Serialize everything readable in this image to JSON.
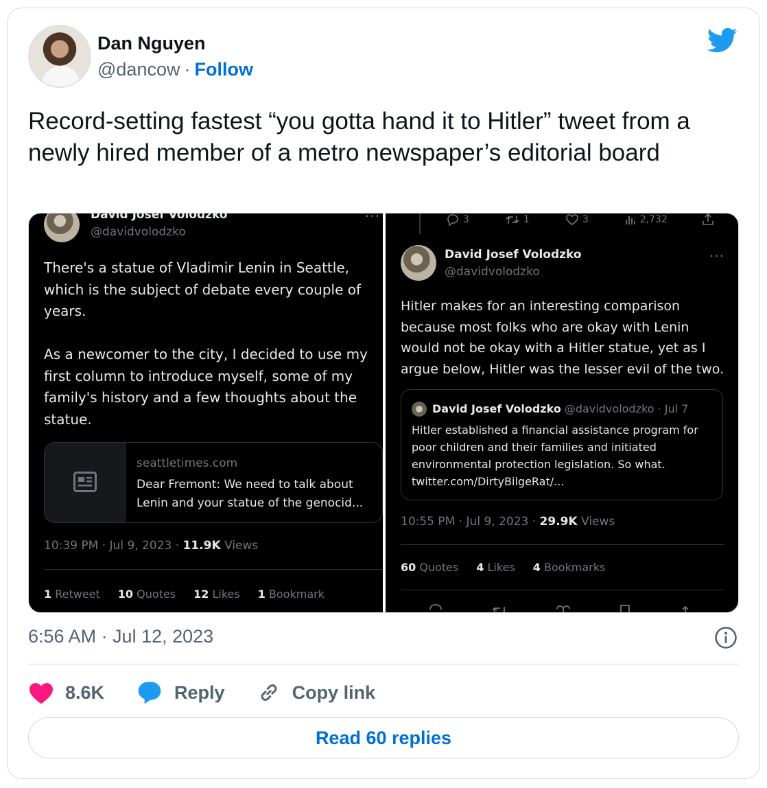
{
  "author": {
    "name": "Dan Nguyen",
    "handle": "@dancow",
    "separator": "·",
    "follow_label": "Follow"
  },
  "tweet": {
    "text": "Record-setting fastest “you gotta hand it to Hitler” tweet from a newly hired member of a metro newspaper’s editorial board",
    "timestamp": "6:56 AM · Jul 12, 2023"
  },
  "left_screenshot": {
    "name": "David Josef Volodzko",
    "handle": "@davidvolodzko",
    "body": "There's a statue of Vladimir Lenin in Seattle, which is the subject of debate every couple of years.\n\nAs a newcomer to the city, I decided to use my first column to introduce myself, some of my family's history and a few thoughts about the statue.",
    "link_domain": "seattletimes.com",
    "link_title": "Dear Fremont: We need to talk about Lenin and your statue of the genocid...",
    "meta_time": "10:39 PM · Jul 9, 2023 · ",
    "meta_views": "11.9K",
    "meta_views_label": " Views",
    "stats": [
      {
        "num": "1",
        "label": " Retweet"
      },
      {
        "num": "10",
        "label": " Quotes"
      },
      {
        "num": "12",
        "label": " Likes"
      },
      {
        "num": "1",
        "label": " Bookmark"
      }
    ]
  },
  "right_screenshot": {
    "top_actions": {
      "replies": "3",
      "retweets": "1",
      "likes": "3",
      "views": "2,732"
    },
    "name": "David Josef Volodzko",
    "handle": "@davidvolodzko",
    "body": "Hitler makes for an interesting comparison because most folks who are okay with Lenin would not be okay with a Hitler statue, yet as I argue below, Hitler was the lesser evil of the two.",
    "quote": {
      "name": "David Josef Volodzko",
      "meta": " @davidvolodzko · Jul 7",
      "body": "Hitler established a financial assistance program for poor children and their families and initiated environmental protection legislation. So what. twitter.com/DirtyBilgeRat/..."
    },
    "meta_time": "10:55 PM · Jul 9, 2023 · ",
    "meta_views": "29.9K",
    "meta_views_label": " Views",
    "stats": [
      {
        "num": "60",
        "label": " Quotes"
      },
      {
        "num": "4",
        "label": " Likes"
      },
      {
        "num": "4",
        "label": " Bookmarks"
      }
    ]
  },
  "actions": {
    "like_count": "8.6K",
    "reply_label": "Reply",
    "copy_link_label": "Copy link"
  },
  "read_replies_label": "Read 60 replies",
  "colors": {
    "twitter_blue": "#1d9bf0",
    "link_blue": "#006fd6",
    "like_pink": "#f91880",
    "secondary_text": "#536471"
  }
}
